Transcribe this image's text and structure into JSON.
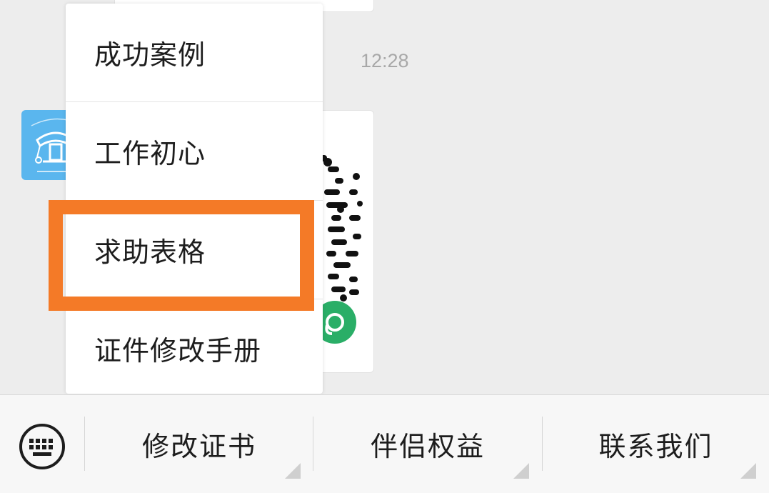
{
  "chat": {
    "timestamp": "12:28"
  },
  "popup_menu": {
    "items": [
      {
        "label": "成功案例"
      },
      {
        "label": "工作初心"
      },
      {
        "label": "求助表格"
      },
      {
        "label": "证件修改手册"
      }
    ],
    "highlighted_item": "求助表格",
    "highlight_color": "#f47a27"
  },
  "bottom_menu": {
    "keyboard_icon": "keyboard-icon",
    "buttons": [
      {
        "label": "修改证书"
      },
      {
        "label": "伴侣权益"
      },
      {
        "label": "联系我们"
      }
    ]
  },
  "colors": {
    "background": "#ededed",
    "avatar_blue": "#5ab6ee",
    "miniprogram_green": "#2aae67"
  }
}
